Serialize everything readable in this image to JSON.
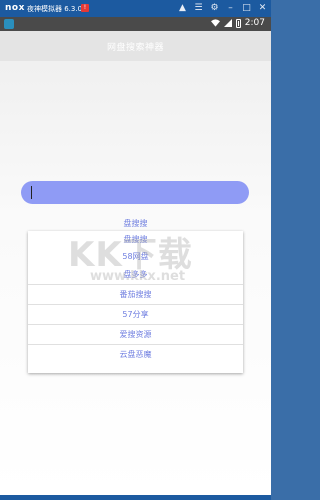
{
  "emulator": {
    "logo": "nox",
    "title": "夜神模拟器 6.3.0.0",
    "badge": "!",
    "icons": [
      "shirt-icon",
      "menu-icon",
      "settings-icon",
      "minimize-icon",
      "maximize-icon",
      "close-icon"
    ]
  },
  "status_bar": {
    "time": "2:07"
  },
  "app": {
    "title": "网盘搜索神器",
    "search": {
      "value": "",
      "accent": "#8f9bf5"
    },
    "suggest_top": "盘搜搜",
    "dropdown_items": [
      "盘搜搜",
      "58网盘",
      "盘多多",
      "番茄搜搜",
      "57分享",
      "爱搜资源",
      "云盘恶魔"
    ],
    "link_color": "#6f7ee0"
  },
  "watermark": {
    "text": "KK下载",
    "url": "www.kkx.net"
  }
}
